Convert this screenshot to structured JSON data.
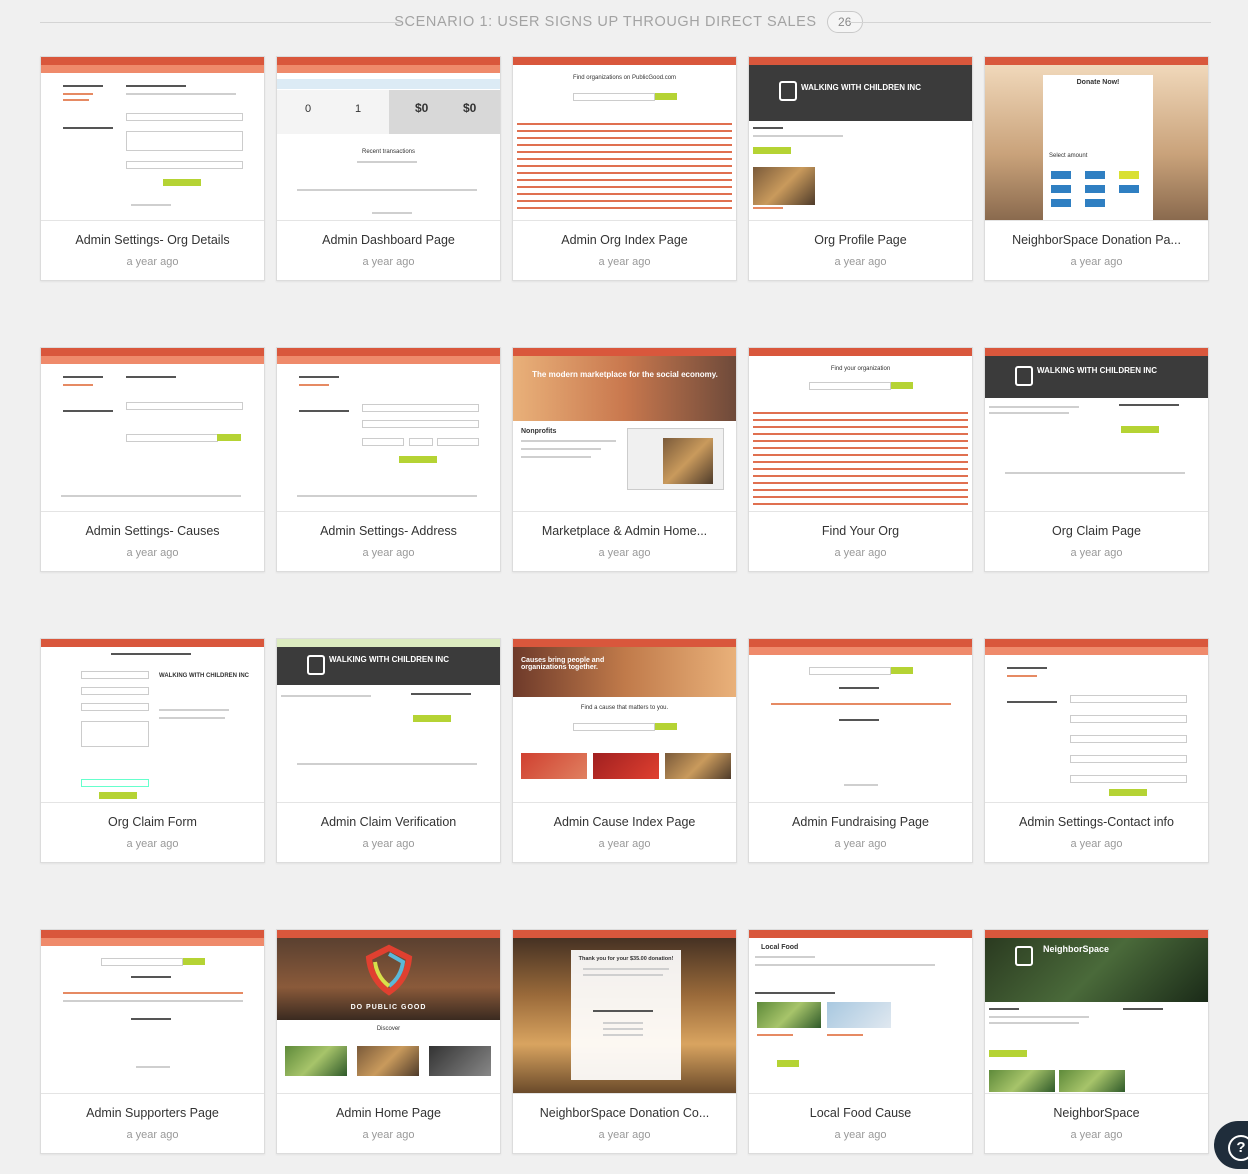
{
  "section": {
    "title": "SCENARIO 1: USER SIGNS UP THROUGH DIRECT SALES",
    "count": "26"
  },
  "help": {
    "icon": "question-icon",
    "glyph": "?"
  },
  "cards": [
    {
      "title": "Admin Settings- Org Details",
      "time": "a year ago"
    },
    {
      "title": "Admin Dashboard Page",
      "time": "a year ago"
    },
    {
      "title": "Admin Org Index Page",
      "time": "a year ago"
    },
    {
      "title": "Org Profile Page",
      "time": "a year ago"
    },
    {
      "title": "NeighborSpace Donation Pa...",
      "time": "a year ago"
    },
    {
      "title": "Admin Settings- Causes",
      "time": "a year ago"
    },
    {
      "title": "Admin Settings- Address",
      "time": "a year ago"
    },
    {
      "title": "Marketplace & Admin Home...",
      "time": "a year ago"
    },
    {
      "title": "Find Your Org",
      "time": "a year ago"
    },
    {
      "title": "Org Claim Page",
      "time": "a year ago"
    },
    {
      "title": "Org Claim Form",
      "time": "a year ago"
    },
    {
      "title": "Admin Claim Verification",
      "time": "a year ago"
    },
    {
      "title": "Admin Cause Index Page",
      "time": "a year ago"
    },
    {
      "title": "Admin Fundraising Page",
      "time": "a year ago"
    },
    {
      "title": "Admin Settings-Contact info",
      "time": "a year ago"
    },
    {
      "title": "Admin Supporters Page",
      "time": "a year ago"
    },
    {
      "title": "Admin Home Page",
      "time": "a year ago"
    },
    {
      "title": "NeighborSpace Donation Co...",
      "time": "a year ago"
    },
    {
      "title": "Local Food Cause",
      "time": "a year ago"
    },
    {
      "title": "NeighborSpace",
      "time": "a year ago"
    }
  ],
  "thumbs": {
    "org_profile_name": "WALKING WITH CHILDREN INC",
    "org_claim_name": "WALKING WITH CHILDREN INC",
    "claim_verif_name": "WALKING WITH CHILDREN INC",
    "donate_heading": "Donate Now!",
    "select_amount": "Select amount",
    "amounts": [
      "$5",
      "$15",
      "$35",
      "$50",
      "$100",
      "$250",
      "$500",
      "$1000"
    ],
    "marketplace_banner": "The modern marketplace for the social economy.",
    "nonprofits": "Nonprofits",
    "find_org": "Find your organization",
    "cause_hero": "Causes bring people and organizations together.",
    "find_cause": "Find a cause that matters to you.",
    "do_public_good": "DO PUBLIC GOOD",
    "discover": "Discover",
    "thanks_donation": "Thank you for your $35.00 donation!",
    "local_food": "Local Food",
    "neighborspace": "NeighborSpace",
    "dashboard_stats": [
      "0",
      "1",
      "$0",
      "$0"
    ],
    "recent_transactions": "Recent transactions",
    "org_index_title": "Find organizations on PublicGood.com"
  }
}
